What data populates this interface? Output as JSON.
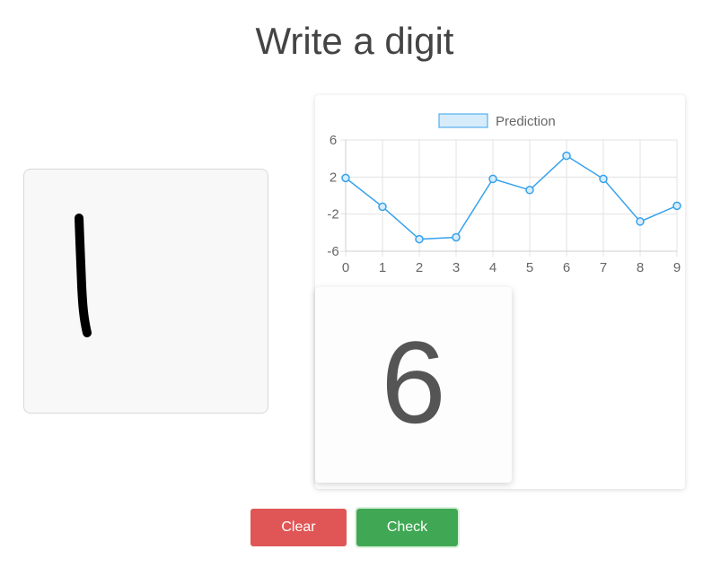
{
  "title": "Write a digit",
  "result": {
    "digit": "6"
  },
  "buttons": {
    "clear": "Clear",
    "check": "Check"
  },
  "colors": {
    "clear_button": "#e05656",
    "check_button": "#40a854",
    "line": "#36a2eb",
    "legend_fill": "#d7ecfb"
  },
  "chart_data": {
    "type": "line",
    "legend": {
      "label": "Prediction",
      "position": "top"
    },
    "categories": [
      "0",
      "1",
      "2",
      "3",
      "4",
      "5",
      "6",
      "7",
      "8",
      "9"
    ],
    "series": [
      {
        "name": "Prediction",
        "values": [
          1.9,
          -1.2,
          -4.7,
          -4.5,
          1.8,
          0.6,
          4.3,
          1.8,
          -2.8,
          -1.1
        ]
      }
    ],
    "yticks": [
      6,
      2,
      -2,
      -6
    ],
    "ylim": [
      -6,
      6
    ],
    "grid": true
  }
}
